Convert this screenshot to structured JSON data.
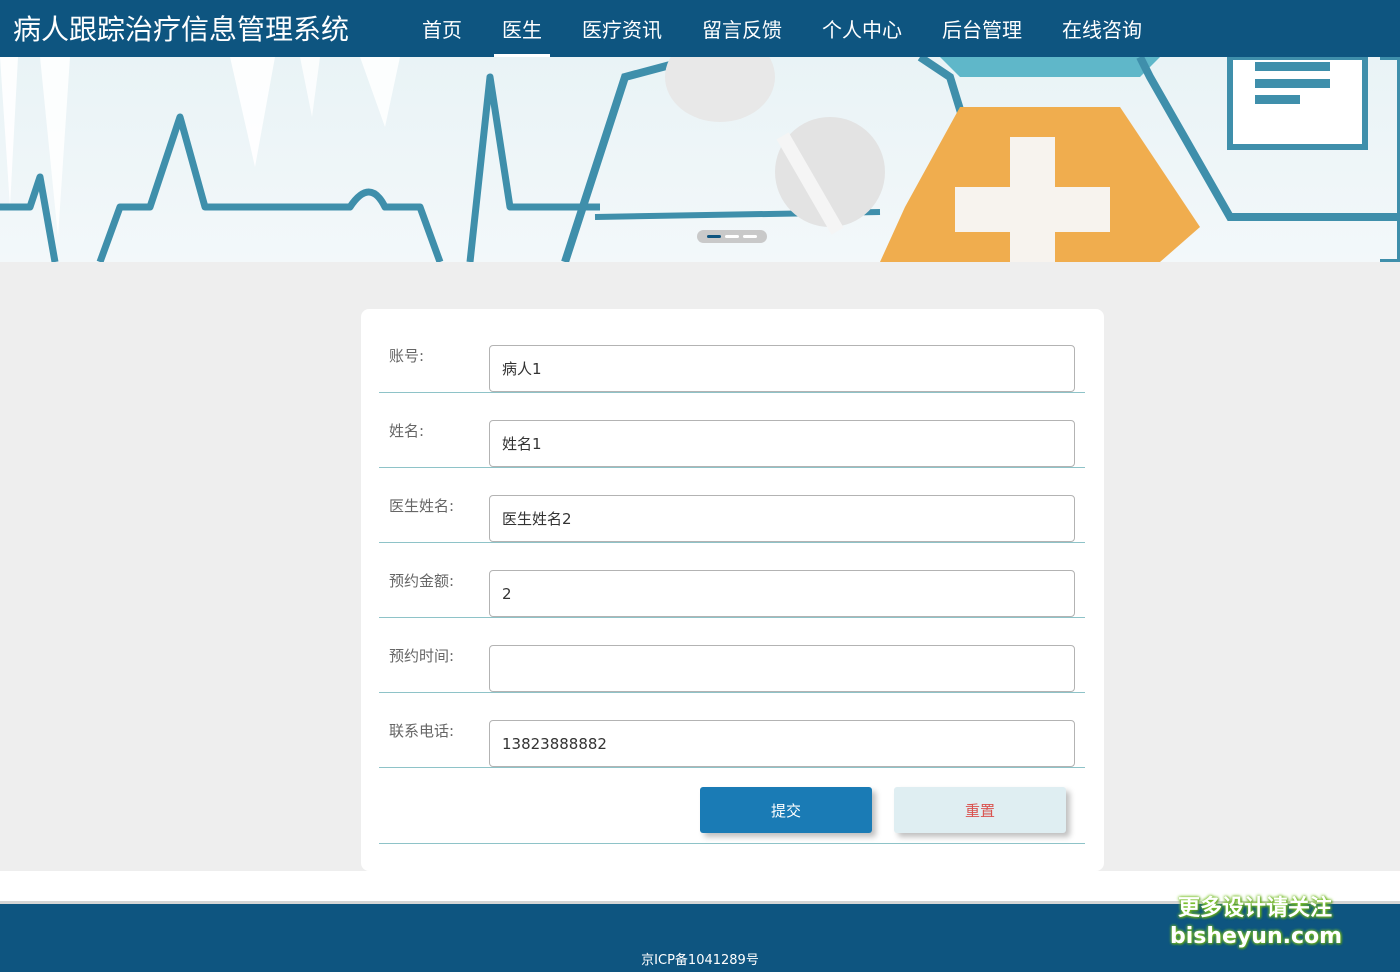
{
  "app": {
    "title": "病人跟踪治疗信息管理系统"
  },
  "nav": {
    "items": [
      {
        "label": "首页"
      },
      {
        "label": "医生"
      },
      {
        "label": "医疗资讯"
      },
      {
        "label": "留言反馈"
      },
      {
        "label": "个人中心"
      },
      {
        "label": "后台管理"
      },
      {
        "label": "在线咨询"
      }
    ],
    "active_index": 1
  },
  "banner": {
    "slide_count": 3,
    "active_slide": 1
  },
  "form": {
    "account": {
      "label": "账号:",
      "value": "病人1"
    },
    "name": {
      "label": "姓名:",
      "value": "姓名1"
    },
    "doctor_name": {
      "label": "医生姓名:",
      "value": "医生姓名2"
    },
    "fee": {
      "label": "预约金额:",
      "value": "2"
    },
    "time": {
      "label": "预约时间:",
      "value": ""
    },
    "phone": {
      "label": "联系电话:",
      "value": "13823888882"
    },
    "submit_label": "提交",
    "reset_label": "重置"
  },
  "footer": {
    "icp": "京ICP备1041289号"
  },
  "watermark": {
    "line1": "更多设计请关注",
    "line2": "bisheyun.com"
  },
  "colors": {
    "primary": "#0e5580",
    "button": "#1a7bb5",
    "reset_text": "#d9534f",
    "divider": "#8ec3c8"
  }
}
